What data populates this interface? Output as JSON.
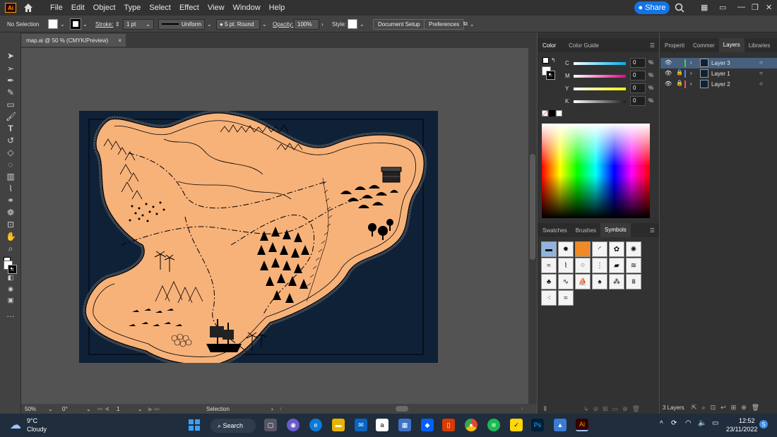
{
  "menubar": {
    "logo": "Ai",
    "items": [
      "File",
      "Edit",
      "Object",
      "Type",
      "Select",
      "Effect",
      "View",
      "Window",
      "Help"
    ],
    "share_label": "Share"
  },
  "controlbar": {
    "selection": "No Selection",
    "stroke_label": "Stroke:",
    "stroke_value": "1 pt",
    "stroke_profile": "Uniform",
    "brush": "5 pt. Round",
    "opacity_label": "Opacity:",
    "opacity_value": "100%",
    "style_label": "Style:",
    "doc_setup": "Document Setup",
    "preferences": "Preferences"
  },
  "document": {
    "tab_title": "map.ai @ 50 % (CMYK/Preview)",
    "close_glyph": "×"
  },
  "statusbar": {
    "zoom": "50%",
    "rotation": "0°",
    "artboard": "1",
    "tool": "Selection"
  },
  "color_panel": {
    "tabs": [
      "Color",
      "Color Guide"
    ],
    "channels": [
      {
        "label": "C",
        "value": "0",
        "color": "#00aeef"
      },
      {
        "label": "M",
        "value": "0",
        "color": "#ec008c"
      },
      {
        "label": "Y",
        "value": "0",
        "color": "#fff200"
      },
      {
        "label": "K",
        "value": "0",
        "color": "#231f20"
      }
    ],
    "unit": "%"
  },
  "symbols_panel": {
    "tabs": [
      "Swatches",
      "Brushes",
      "Symbols"
    ],
    "count": 20
  },
  "layers_panel": {
    "tabs": [
      "Properti",
      "Commer",
      "Layers",
      "Libraries"
    ],
    "layers": [
      {
        "name": "Layer 3",
        "color": "#4fc94f"
      },
      {
        "name": "Layer 1",
        "color": "#4f7fff"
      },
      {
        "name": "Layer 2",
        "color": "#ff4f4f"
      }
    ],
    "footer": "3 Layers"
  },
  "taskbar": {
    "weather_temp": "9°C",
    "weather_desc": "Cloudy",
    "search_label": "Search",
    "time": "12:52",
    "date": "23/11/2022",
    "ai_label": "Ai",
    "ps_label": "Ps"
  },
  "colors": {
    "artboard_bg": "#0f2136",
    "land": "#f7b27a",
    "accent": "#1473e6"
  }
}
